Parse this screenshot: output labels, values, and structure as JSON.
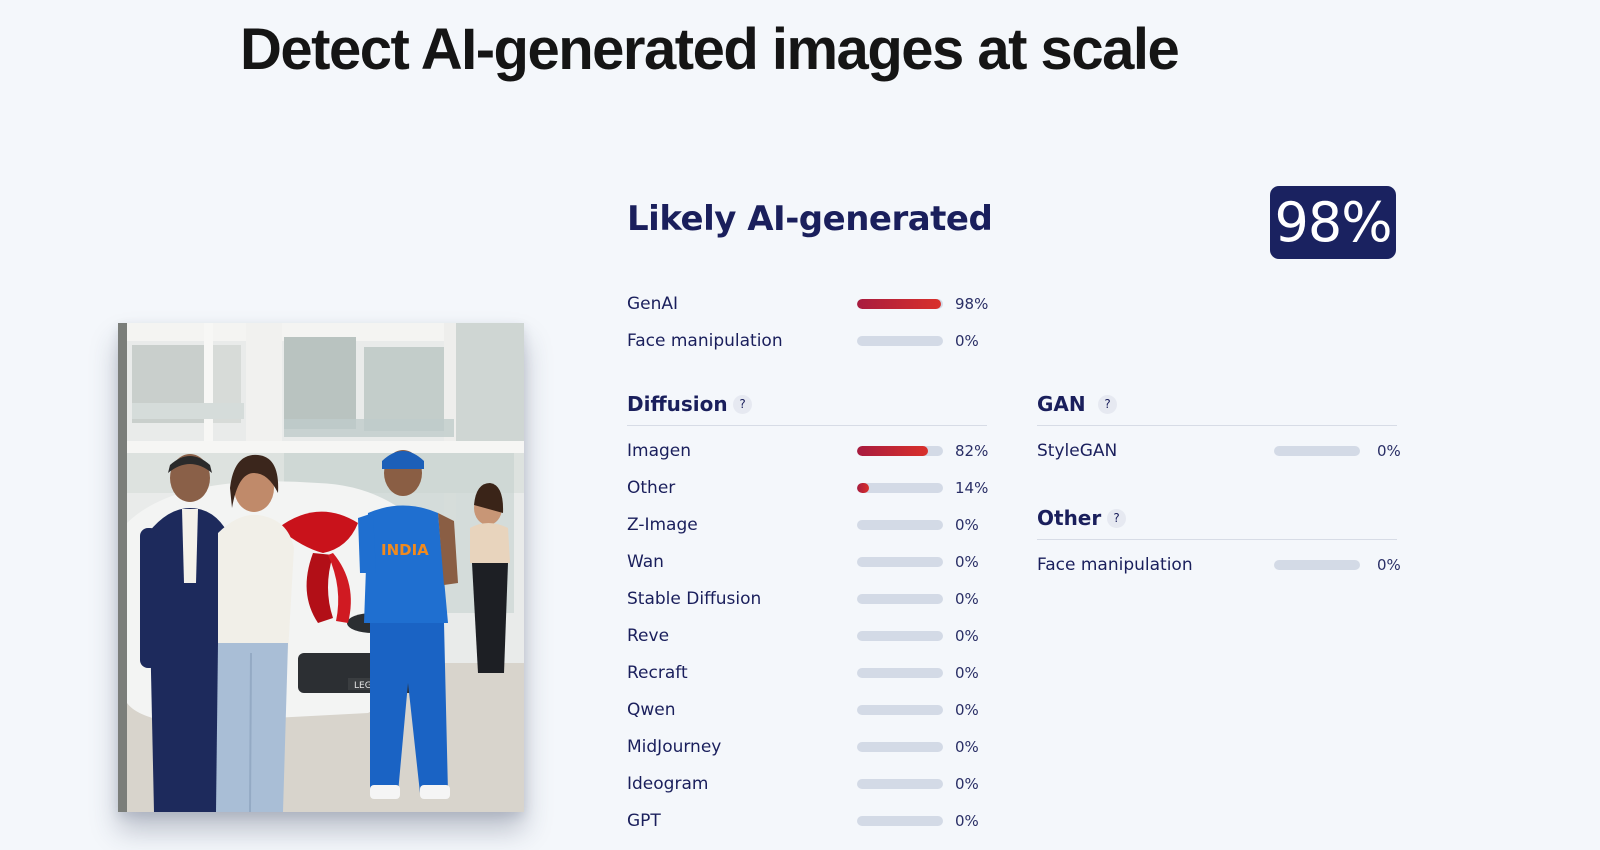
{
  "page": {
    "title": "Detect AI-generated images at scale"
  },
  "verdict": {
    "label": "Likely AI-generated",
    "score": "98%"
  },
  "summary": [
    {
      "label": "GenAI",
      "value": "98%",
      "fraction": 0.98
    },
    {
      "label": "Face manipulation",
      "value": "0%",
      "fraction": 0
    }
  ],
  "sections": {
    "diffusion": {
      "title": "Diffusion",
      "help": "?",
      "items": [
        {
          "label": "Imagen",
          "value": "82%",
          "fraction": 0.82
        },
        {
          "label": "Other",
          "value": "14%",
          "fraction": 0.14
        },
        {
          "label": "Z-Image",
          "value": "0%",
          "fraction": 0
        },
        {
          "label": "Wan",
          "value": "0%",
          "fraction": 0
        },
        {
          "label": "Stable Diffusion",
          "value": "0%",
          "fraction": 0
        },
        {
          "label": "Reve",
          "value": "0%",
          "fraction": 0
        },
        {
          "label": "Recraft",
          "value": "0%",
          "fraction": 0
        },
        {
          "label": "Qwen",
          "value": "0%",
          "fraction": 0
        },
        {
          "label": "MidJourney",
          "value": "0%",
          "fraction": 0
        },
        {
          "label": "Ideogram",
          "value": "0%",
          "fraction": 0
        },
        {
          "label": "GPT",
          "value": "0%",
          "fraction": 0
        }
      ]
    },
    "gan": {
      "title": "GAN",
      "help": "?",
      "items": [
        {
          "label": "StyleGAN",
          "value": "0%",
          "fraction": 0
        }
      ]
    },
    "other": {
      "title": "Other",
      "help": "?",
      "items": [
        {
          "label": "Face manipulation",
          "value": "0%",
          "fraction": 0
        }
      ]
    }
  },
  "photo": {
    "jersey_text": "INDIA",
    "plate_text": "LEGE"
  },
  "colors": {
    "background": "#f4f7fb",
    "navy": "#1a2260",
    "bar_fill_start": "#a81c3f",
    "bar_fill_end": "#d9302b",
    "bar_track": "#d3dae6"
  }
}
